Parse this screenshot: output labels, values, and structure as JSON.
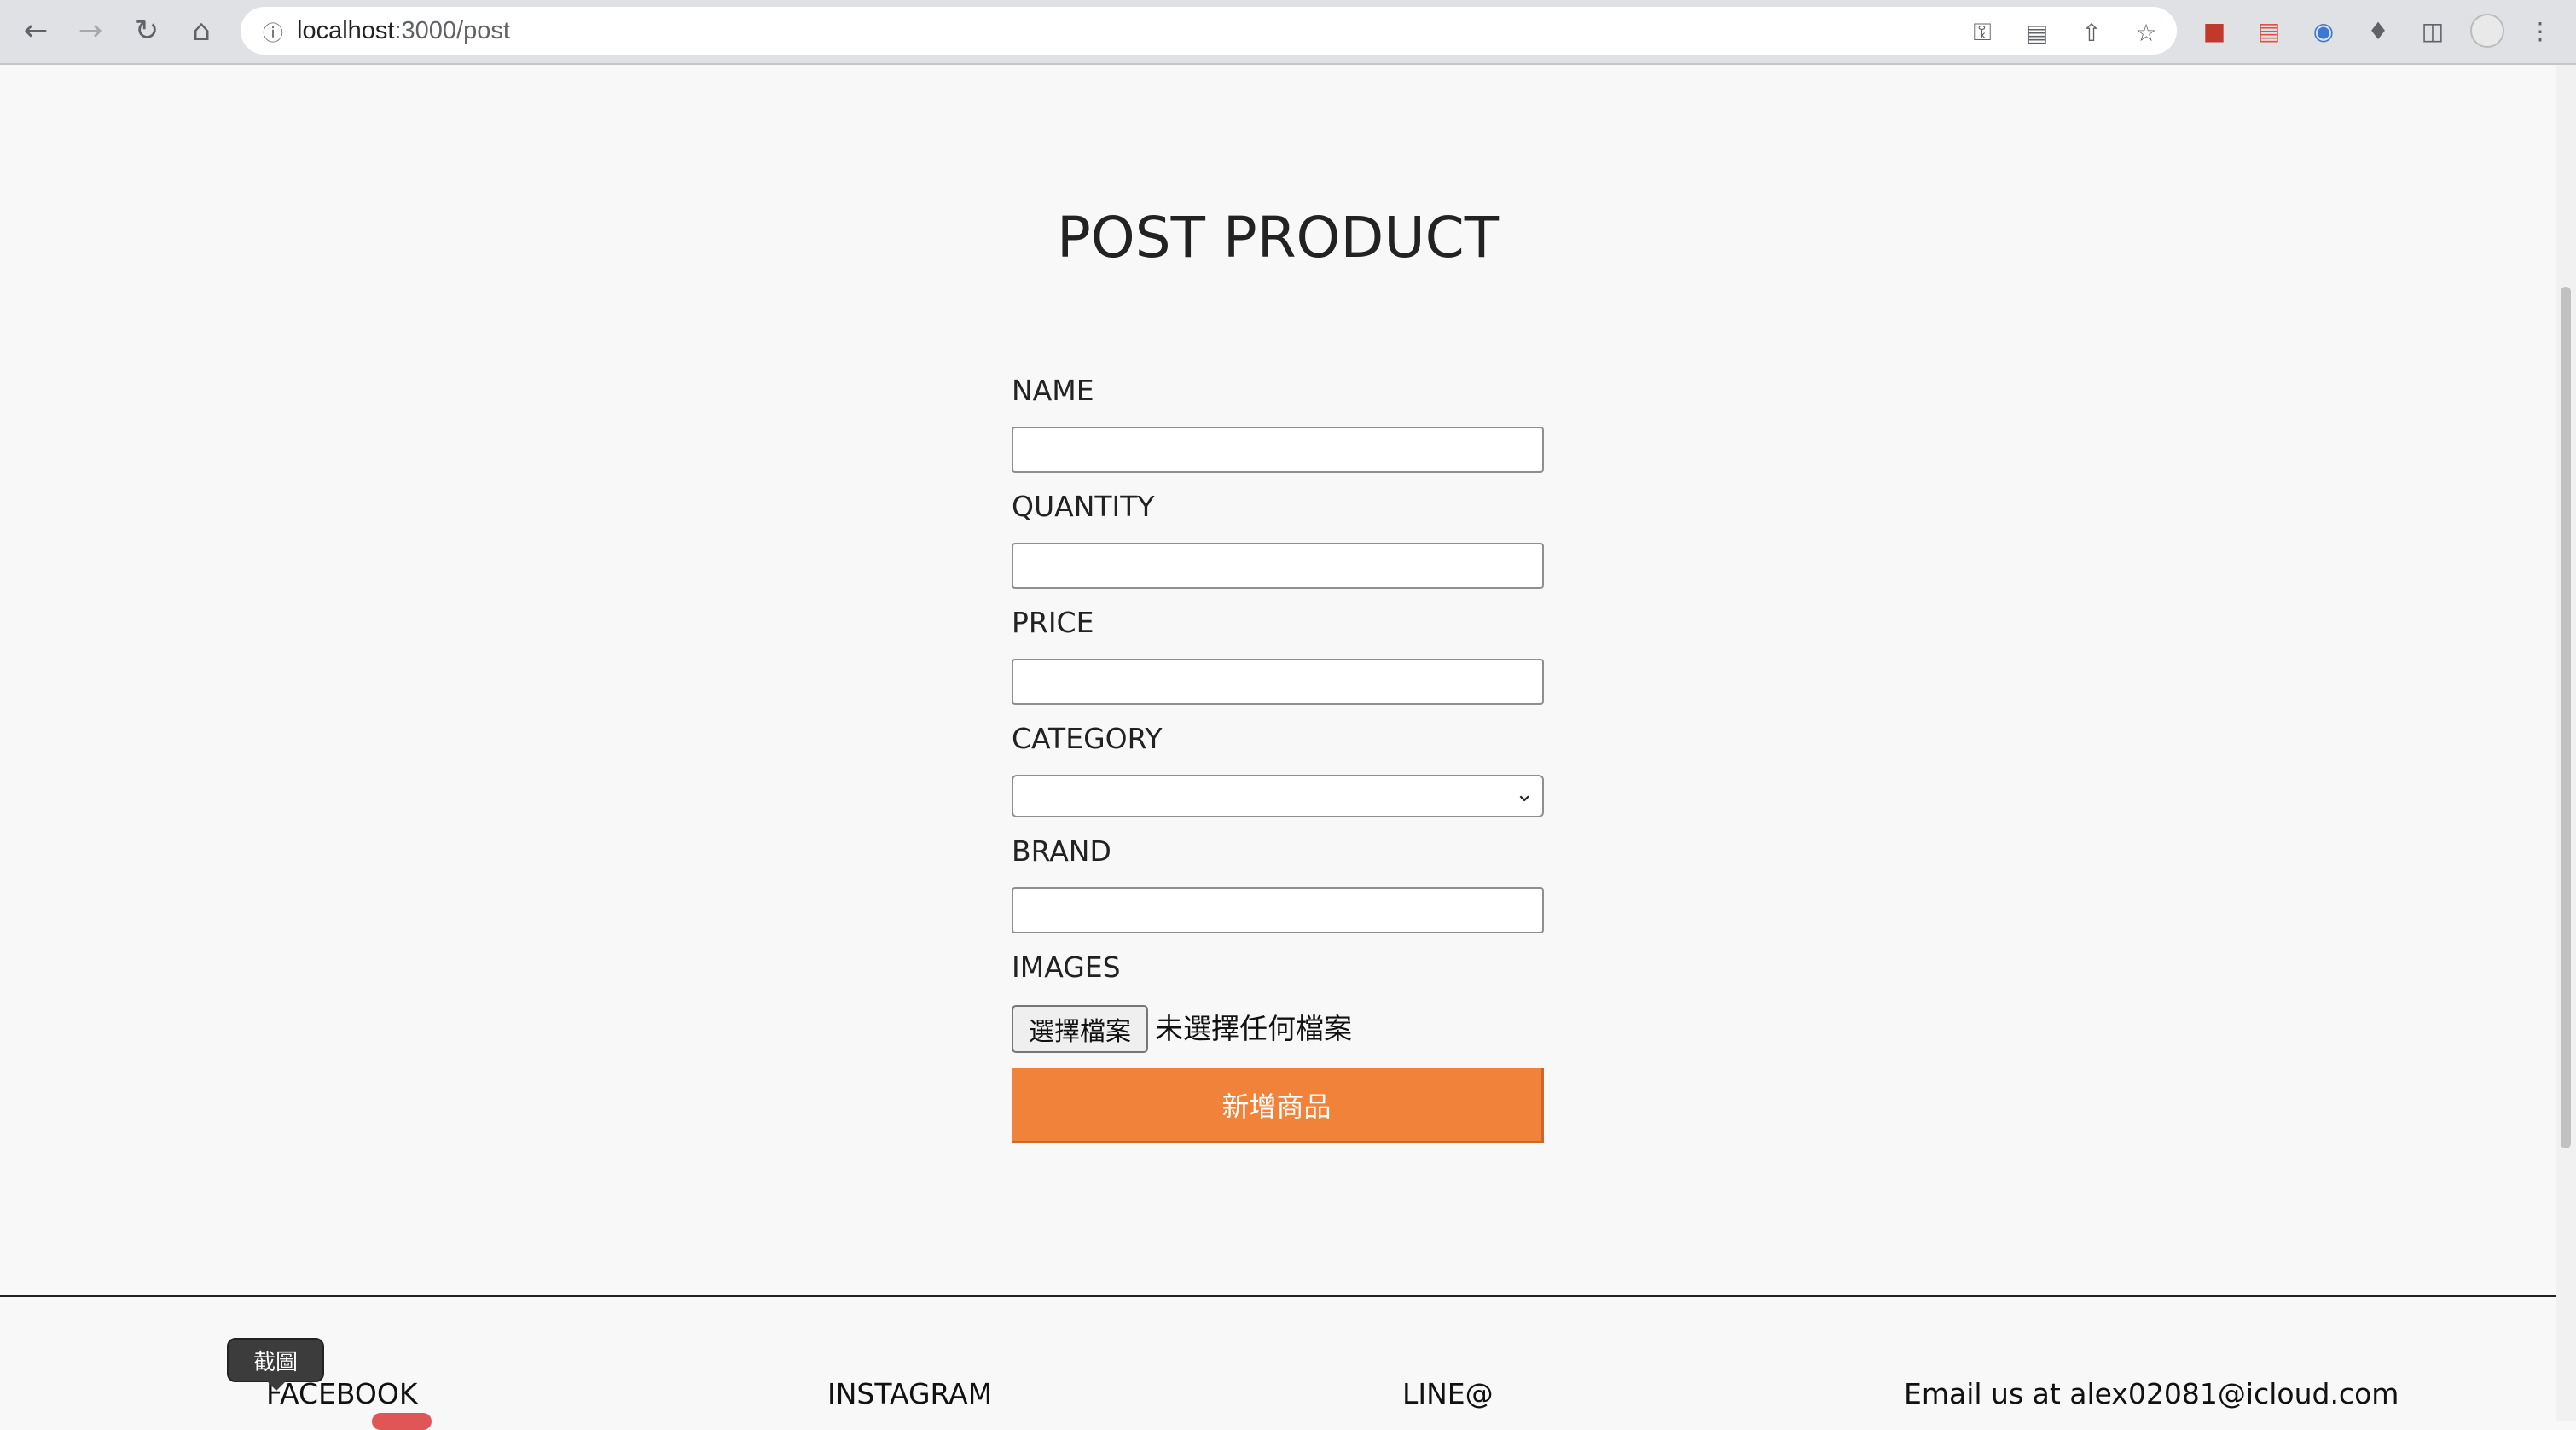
{
  "browser": {
    "url_host": "localhost",
    "url_rest": ":3000/post"
  },
  "page": {
    "title": "POST PRODUCT",
    "fields": {
      "name_label": "NAME",
      "name_value": "",
      "quantity_label": "QUANTITY",
      "quantity_value": "",
      "price_label": "PRICE",
      "price_value": "",
      "category_label": "CATEGORY",
      "category_selected": "",
      "brand_label": "BRAND",
      "brand_value": "",
      "images_label": "IMAGES",
      "file_button": "選擇檔案",
      "file_status": "未選擇任何檔案"
    },
    "submit_label": "新增商品",
    "accent_color": "#f0823a"
  },
  "footer": {
    "facebook": "FACEBOOK",
    "instagram": "INSTAGRAM",
    "line": "LINE@",
    "email": "Email us at alex02081@icloud.com"
  },
  "tooltip": {
    "text": "截圖"
  }
}
